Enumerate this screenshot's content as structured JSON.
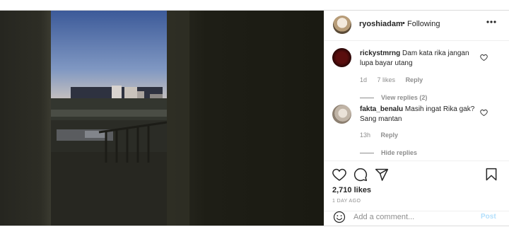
{
  "header": {
    "username": "ryoshiadam",
    "separator": "•",
    "follow_status": "Following",
    "more_icon": "more-horizontal-icon"
  },
  "comments": [
    {
      "username": "rickystmrng",
      "text": "Dam kata rika jangan lupa bayar utang",
      "age": "1d",
      "likes": "7 likes",
      "reply_label": "Reply",
      "replies_toggle": "View replies (2)"
    },
    {
      "username": "fakta_benalu",
      "text": "Masih ingat Rika gak? Sang mantan",
      "age": "13h",
      "reply_label": "Reply",
      "replies_toggle": "Hide replies"
    }
  ],
  "actions": {
    "icons": [
      "heart-icon",
      "comment-icon",
      "share-icon",
      "bookmark-icon"
    ],
    "likes_count": "2,710 likes",
    "timestamp": "1 DAY AGO"
  },
  "add_comment": {
    "emoji_icon": "emoji-icon",
    "placeholder": "Add a comment...",
    "post_label": "Post"
  },
  "colors": {
    "border": "#dbdbdb",
    "secondary_text": "#8e8e8e",
    "post_button_disabled": "#b2dffc"
  }
}
